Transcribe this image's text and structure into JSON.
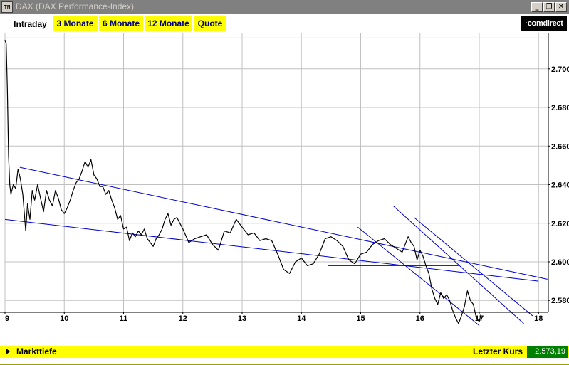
{
  "window": {
    "icon_label": "TM",
    "title": "DAX (DAX Performance-Index)",
    "buttons": {
      "minimize": "_",
      "restore": "❐",
      "close": "✕"
    }
  },
  "tabs": [
    {
      "label": "Intraday",
      "active": true
    },
    {
      "label": "3 Monate",
      "active": false
    },
    {
      "label": "6 Monate",
      "active": false
    },
    {
      "label": "12 Monate",
      "active": false
    },
    {
      "label": "Quote",
      "active": false
    }
  ],
  "brand": {
    "logo_text": "·comdirect"
  },
  "status": {
    "marktiefe_label": "Markttiefe",
    "last_price_label": "Letzter Kurs",
    "last_price_value": "2.573,19"
  },
  "colors": {
    "accent_yellow": "#ffff00",
    "price_line": "#000000",
    "trendline": "#0000cc",
    "grid": "#c0c0c0",
    "reference_line": "#ffd700",
    "last_price_bg": "#008000"
  },
  "chart_data": {
    "type": "line",
    "x_ticks": [
      "9",
      "10",
      "11",
      "12",
      "13",
      "14",
      "15",
      "16",
      "17",
      "18"
    ],
    "y_ticks": [
      "2.580",
      "2.600",
      "2.620",
      "2.640",
      "2.660",
      "2.680",
      "2.700"
    ],
    "y_tick_values": [
      2580,
      2600,
      2620,
      2640,
      2660,
      2680,
      2700
    ],
    "xlim": [
      9,
      18
    ],
    "ylim": [
      2566,
      2719
    ],
    "grid": true,
    "reference_level": 2716,
    "series": [
      {
        "values": [
          [
            9.0,
            2715
          ],
          [
            9.02,
            2713
          ],
          [
            9.04,
            2690
          ],
          [
            9.06,
            2655
          ],
          [
            9.08,
            2640
          ],
          [
            9.1,
            2635
          ],
          [
            9.14,
            2640
          ],
          [
            9.18,
            2638
          ],
          [
            9.22,
            2648
          ],
          [
            9.26,
            2643
          ],
          [
            9.3,
            2635
          ],
          [
            9.35,
            2616
          ],
          [
            9.38,
            2630
          ],
          [
            9.42,
            2622
          ],
          [
            9.46,
            2637
          ],
          [
            9.5,
            2632
          ],
          [
            9.55,
            2640
          ],
          [
            9.6,
            2633
          ],
          [
            9.65,
            2626
          ],
          [
            9.7,
            2637
          ],
          [
            9.75,
            2632
          ],
          [
            9.8,
            2629
          ],
          [
            9.85,
            2637
          ],
          [
            9.9,
            2633
          ],
          [
            9.95,
            2627
          ],
          [
            10.0,
            2625
          ],
          [
            10.05,
            2628
          ],
          [
            10.1,
            2632
          ],
          [
            10.15,
            2637
          ],
          [
            10.2,
            2641
          ],
          [
            10.25,
            2643
          ],
          [
            10.3,
            2647
          ],
          [
            10.35,
            2652
          ],
          [
            10.4,
            2649
          ],
          [
            10.45,
            2653
          ],
          [
            10.5,
            2645
          ],
          [
            10.55,
            2643
          ],
          [
            10.6,
            2639
          ],
          [
            10.65,
            2639
          ],
          [
            10.7,
            2635
          ],
          [
            10.75,
            2637
          ],
          [
            10.8,
            2632
          ],
          [
            10.85,
            2628
          ],
          [
            10.9,
            2622
          ],
          [
            10.95,
            2624
          ],
          [
            11.0,
            2617
          ],
          [
            11.05,
            2618
          ],
          [
            11.1,
            2611
          ],
          [
            11.15,
            2615
          ],
          [
            11.2,
            2613
          ],
          [
            11.25,
            2616
          ],
          [
            11.3,
            2614
          ],
          [
            11.35,
            2617
          ],
          [
            11.4,
            2612
          ],
          [
            11.45,
            2610
          ],
          [
            11.5,
            2608
          ],
          [
            11.55,
            2612
          ],
          [
            11.6,
            2614
          ],
          [
            11.65,
            2617
          ],
          [
            11.7,
            2622
          ],
          [
            11.75,
            2625
          ],
          [
            11.8,
            2619
          ],
          [
            11.85,
            2622
          ],
          [
            11.9,
            2623
          ],
          [
            11.95,
            2620
          ],
          [
            12.0,
            2617
          ],
          [
            12.1,
            2610
          ],
          [
            12.2,
            2612
          ],
          [
            12.3,
            2613
          ],
          [
            12.4,
            2614
          ],
          [
            12.5,
            2609
          ],
          [
            12.6,
            2606
          ],
          [
            12.7,
            2616
          ],
          [
            12.8,
            2615
          ],
          [
            12.9,
            2622
          ],
          [
            13.0,
            2618
          ],
          [
            13.1,
            2614
          ],
          [
            13.2,
            2615
          ],
          [
            13.3,
            2611
          ],
          [
            13.4,
            2612
          ],
          [
            13.5,
            2611
          ],
          [
            13.6,
            2604
          ],
          [
            13.7,
            2596
          ],
          [
            13.8,
            2594
          ],
          [
            13.9,
            2600
          ],
          [
            14.0,
            2602
          ],
          [
            14.1,
            2598
          ],
          [
            14.2,
            2599
          ],
          [
            14.3,
            2604
          ],
          [
            14.4,
            2612
          ],
          [
            14.5,
            2613
          ],
          [
            14.6,
            2611
          ],
          [
            14.7,
            2608
          ],
          [
            14.8,
            2601
          ],
          [
            14.9,
            2599
          ],
          [
            15.0,
            2604
          ],
          [
            15.1,
            2605
          ],
          [
            15.2,
            2609
          ],
          [
            15.3,
            2611
          ],
          [
            15.4,
            2612
          ],
          [
            15.5,
            2609
          ],
          [
            15.6,
            2607
          ],
          [
            15.7,
            2605
          ],
          [
            15.8,
            2613
          ],
          [
            15.85,
            2610
          ],
          [
            15.9,
            2608
          ],
          [
            15.95,
            2601
          ],
          [
            16.0,
            2606
          ],
          [
            16.05,
            2603
          ],
          [
            16.1,
            2598
          ],
          [
            16.15,
            2594
          ],
          [
            16.2,
            2586
          ],
          [
            16.25,
            2581
          ],
          [
            16.3,
            2578
          ],
          [
            16.35,
            2584
          ],
          [
            16.4,
            2581
          ],
          [
            16.45,
            2583
          ],
          [
            16.5,
            2580
          ],
          [
            16.55,
            2575
          ],
          [
            16.6,
            2571
          ],
          [
            16.65,
            2568
          ],
          [
            16.7,
            2572
          ],
          [
            16.75,
            2577
          ],
          [
            16.8,
            2585
          ],
          [
            16.85,
            2580
          ],
          [
            16.9,
            2578
          ],
          [
            16.95,
            2571
          ],
          [
            17.0,
            2569
          ],
          [
            17.03,
            2573
          ]
        ]
      }
    ],
    "trendlines": [
      {
        "from": [
          9.0,
          2622
        ],
        "to": [
          18.0,
          2590
        ]
      },
      {
        "from": [
          9.25,
          2649
        ],
        "to": [
          18.15,
          2591
        ]
      },
      {
        "from": [
          14.45,
          2598
        ],
        "to": [
          16.65,
          2598
        ]
      },
      {
        "from": [
          15.9,
          2623
        ],
        "to": [
          17.9,
          2572
        ]
      },
      {
        "from": [
          15.55,
          2629
        ],
        "to": [
          17.75,
          2568
        ]
      },
      {
        "from": [
          14.95,
          2618
        ],
        "to": [
          17.0,
          2567
        ]
      }
    ]
  }
}
